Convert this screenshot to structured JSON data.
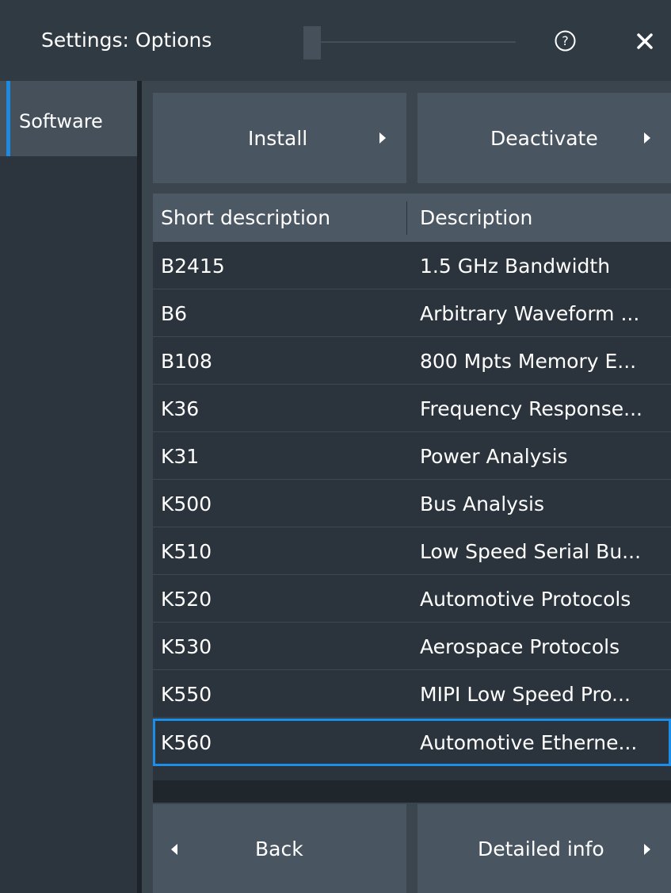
{
  "window": {
    "title": "Settings: Options",
    "help_icon": "question-circle-icon",
    "close_icon": "close-icon"
  },
  "sidebar": {
    "items": [
      {
        "label": "Software",
        "selected": true
      }
    ]
  },
  "toolbar": {
    "install_label": "Install",
    "deactivate_label": "Deactivate"
  },
  "table": {
    "columns": [
      "Short description",
      "Description"
    ],
    "rows": [
      {
        "short": "B2415",
        "description": "1.5 GHz Bandwidth"
      },
      {
        "short": "B6",
        "description": "Arbitrary Waveform ..."
      },
      {
        "short": "B108",
        "description": "800 Mpts Memory E..."
      },
      {
        "short": "K36",
        "description": "Frequency Response..."
      },
      {
        "short": "K31",
        "description": "Power Analysis"
      },
      {
        "short": "K500",
        "description": "Bus Analysis"
      },
      {
        "short": "K510",
        "description": "Low Speed Serial Bu..."
      },
      {
        "short": "K520",
        "description": "Automotive Protocols"
      },
      {
        "short": "K530",
        "description": "Aerospace Protocols"
      },
      {
        "short": "K550",
        "description": "MIPI Low Speed Pro..."
      },
      {
        "short": "K560",
        "description": "Automotive Etherne...",
        "selected": true
      }
    ]
  },
  "footer": {
    "back_label": "Back",
    "detailed_info_label": "Detailed info"
  },
  "colors": {
    "accent": "#1d8ae0",
    "background": "#1d2329",
    "button": "#495560"
  }
}
